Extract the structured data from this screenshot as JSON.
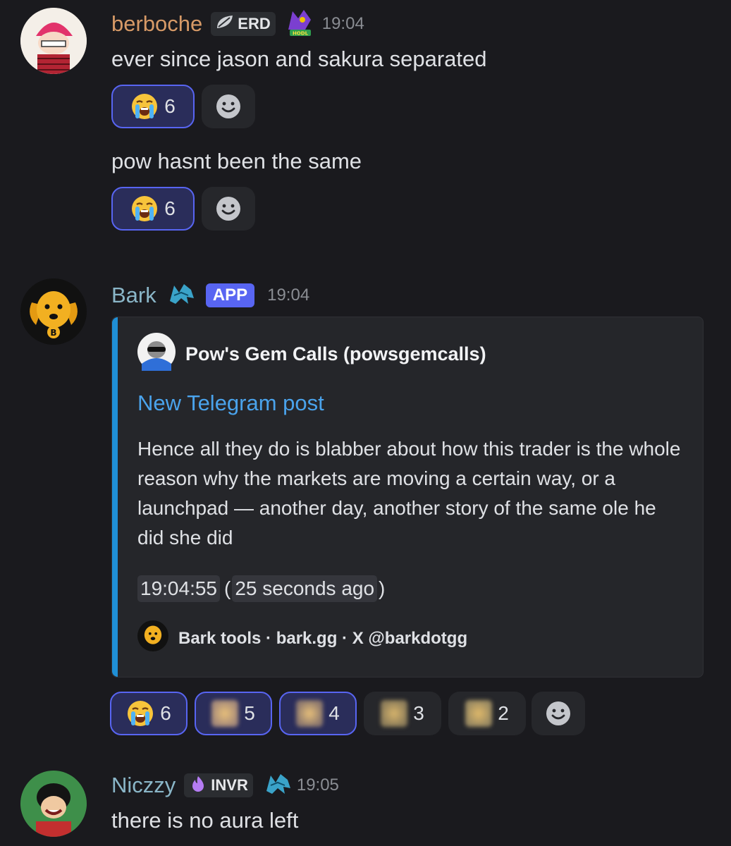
{
  "messages": [
    {
      "username": "berboche",
      "username_color": "#d79a67",
      "tag": "ERD",
      "timestamp": "19:04",
      "lines": [
        {
          "text": "ever since jason and sakura separated",
          "reaction_count": "6"
        },
        {
          "text": "pow hasnt been the same",
          "reaction_count": "6"
        }
      ]
    },
    {
      "username": "Bark",
      "username_color": "#8ab6c8",
      "app_tag": "APP",
      "timestamp": "19:04",
      "embed": {
        "author": "Pow's Gem Calls (powsgemcalls)",
        "title": "New Telegram post",
        "description": "Hence all they do is blabber about how this trader is the whole reason why the markets are moving a certain way, or a launchpad — another day, another story of the same ole he did she did",
        "time": "19:04:55",
        "relative_time": "25 seconds ago",
        "footer": "Bark tools · bark.gg · X @barkdotgg",
        "accent": "#1f8fd6"
      },
      "reactions": [
        {
          "emoji": "loudly-crying-face",
          "count": "6",
          "mine": true
        },
        {
          "emoji": "blurred-emoji",
          "count": "5",
          "mine": true
        },
        {
          "emoji": "blurred-emoji",
          "count": "4",
          "mine": true
        },
        {
          "emoji": "blurred-emoji",
          "count": "3",
          "mine": false
        },
        {
          "emoji": "blurred-emoji",
          "count": "2",
          "mine": false
        }
      ]
    },
    {
      "username": "Niczzy",
      "username_color": "#8ab6c8",
      "tag": "INVR",
      "timestamp": "19:05",
      "lines": [
        {
          "text": "there is no aura left"
        }
      ]
    }
  ]
}
